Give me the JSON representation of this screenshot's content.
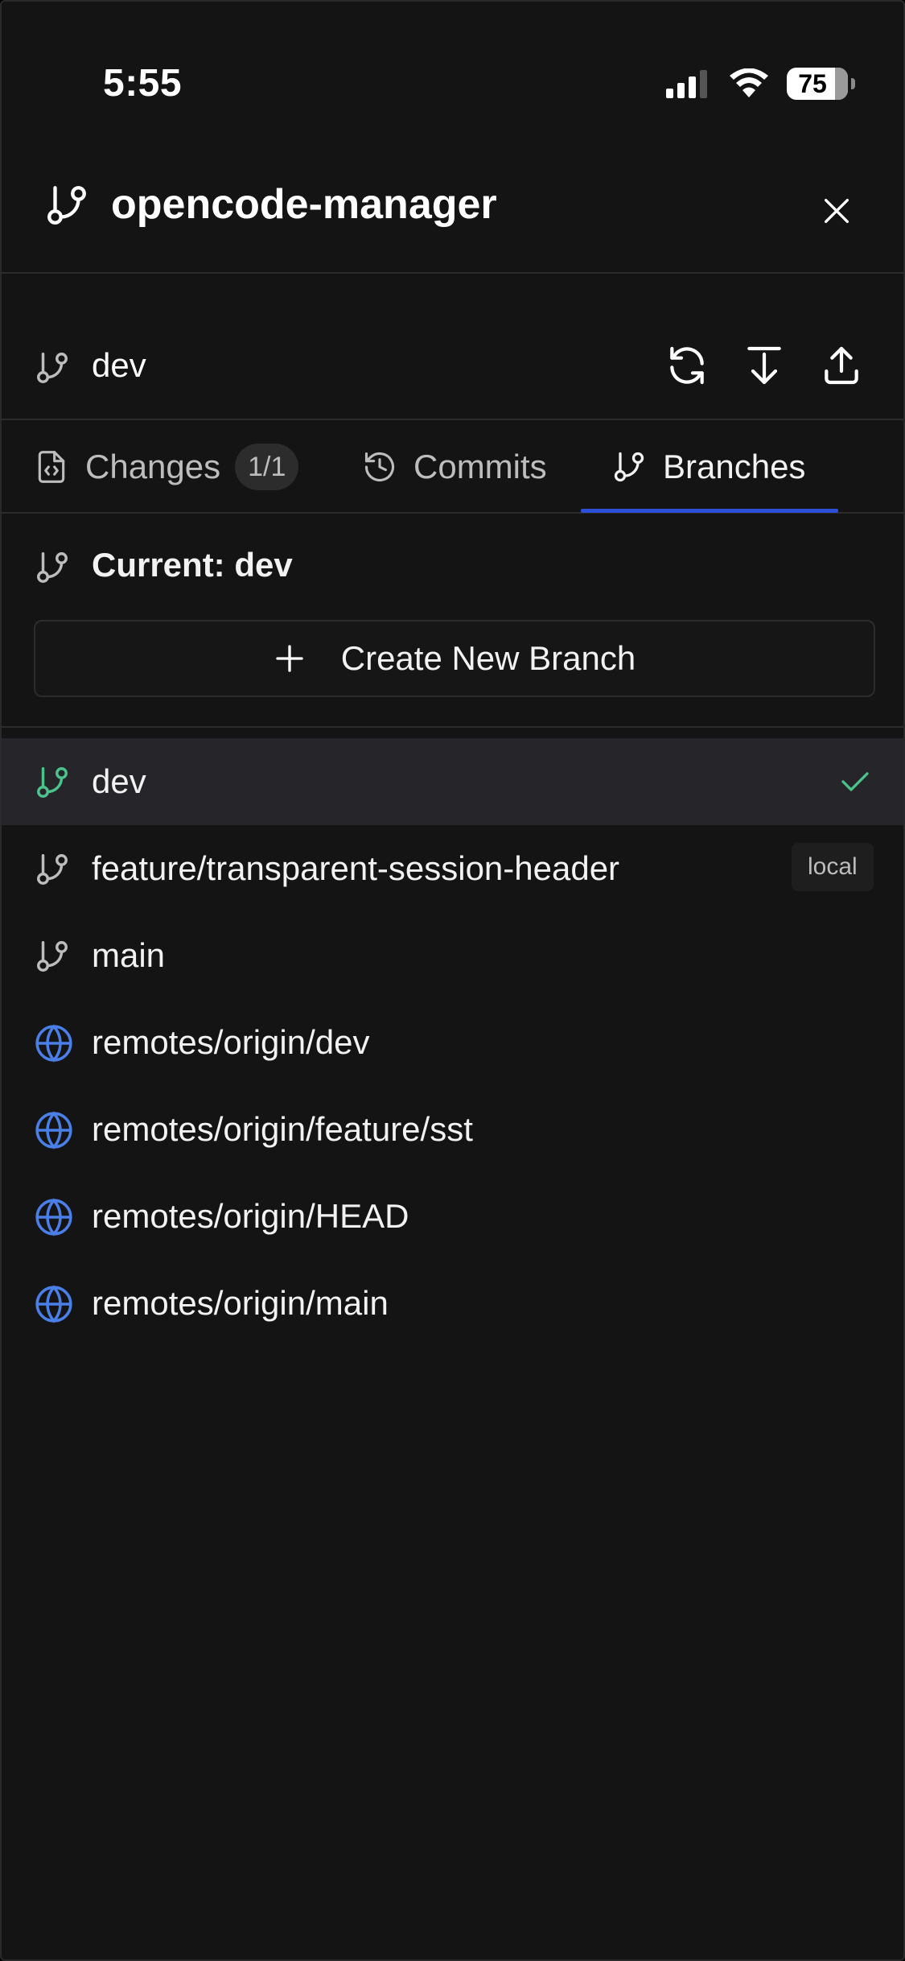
{
  "status_bar": {
    "time": "5:55",
    "battery": "75"
  },
  "header": {
    "title": "opencode-manager"
  },
  "branch_bar": {
    "current_branch": "dev"
  },
  "tabs": [
    {
      "label": "Changes",
      "badge": "1/1",
      "icon": "file-code-icon"
    },
    {
      "label": "Commits",
      "icon": "history-icon"
    },
    {
      "label": "Branches",
      "icon": "git-branch-icon",
      "active": true
    }
  ],
  "current": {
    "label": "Current: dev"
  },
  "create_button": {
    "label": "Create New Branch"
  },
  "branches": [
    {
      "name": "dev",
      "type": "local",
      "selected": true
    },
    {
      "name": "feature/transparent-session-header",
      "type": "local",
      "badge": "local"
    },
    {
      "name": "main",
      "type": "local"
    },
    {
      "name": "remotes/origin/dev",
      "type": "remote"
    },
    {
      "name": "remotes/origin/feature/sst",
      "type": "remote"
    },
    {
      "name": "remotes/origin/HEAD",
      "type": "remote"
    },
    {
      "name": "remotes/origin/main",
      "type": "remote"
    }
  ],
  "colors": {
    "background": "#141414",
    "accent_underline": "#2d4fd6",
    "selected_branch": "#4cc38a",
    "remote_globe": "#4a7fe8"
  }
}
